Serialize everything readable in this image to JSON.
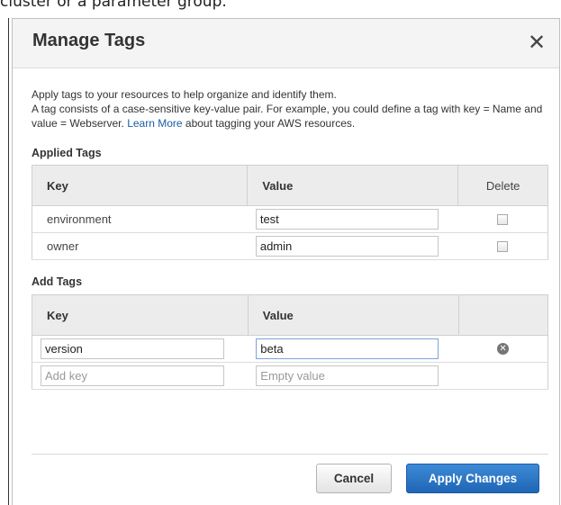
{
  "page": {
    "top_fragment_text": "cluster or a parameter group."
  },
  "dialog": {
    "title": "Manage Tags",
    "close_symbol": "✕",
    "description": {
      "line1": "Apply tags to your resources to help organize and identify them.",
      "line2_prefix": "A tag consists of a case-sensitive key-value pair. For example, you could define a tag with key = Name and value = Webserver.",
      "link_text": "Learn More",
      "line2_suffix": "about tagging your AWS resources."
    }
  },
  "applied_tags": {
    "label": "Applied Tags",
    "columns": {
      "key": "Key",
      "value": "Value",
      "delete": "Delete"
    },
    "rows": [
      {
        "key": "environment",
        "value": "test",
        "delete_checked": false
      },
      {
        "key": "owner",
        "value": "admin",
        "delete_checked": false
      }
    ]
  },
  "add_tags": {
    "label": "Add Tags",
    "columns": {
      "key": "Key",
      "value": "Value"
    },
    "rows": [
      {
        "key": "version",
        "value": "beta"
      }
    ],
    "new_row": {
      "key_placeholder": "Add key",
      "value_placeholder": "Empty value"
    },
    "remove_icon": "remove-circle-icon"
  },
  "footer": {
    "cancel_label": "Cancel",
    "apply_label": "Apply Changes"
  },
  "colors": {
    "primary_button": "#2a74c4",
    "link": "#1a5ea8",
    "header_bg": "#f4f4f4",
    "table_header_bg": "#ececec"
  }
}
